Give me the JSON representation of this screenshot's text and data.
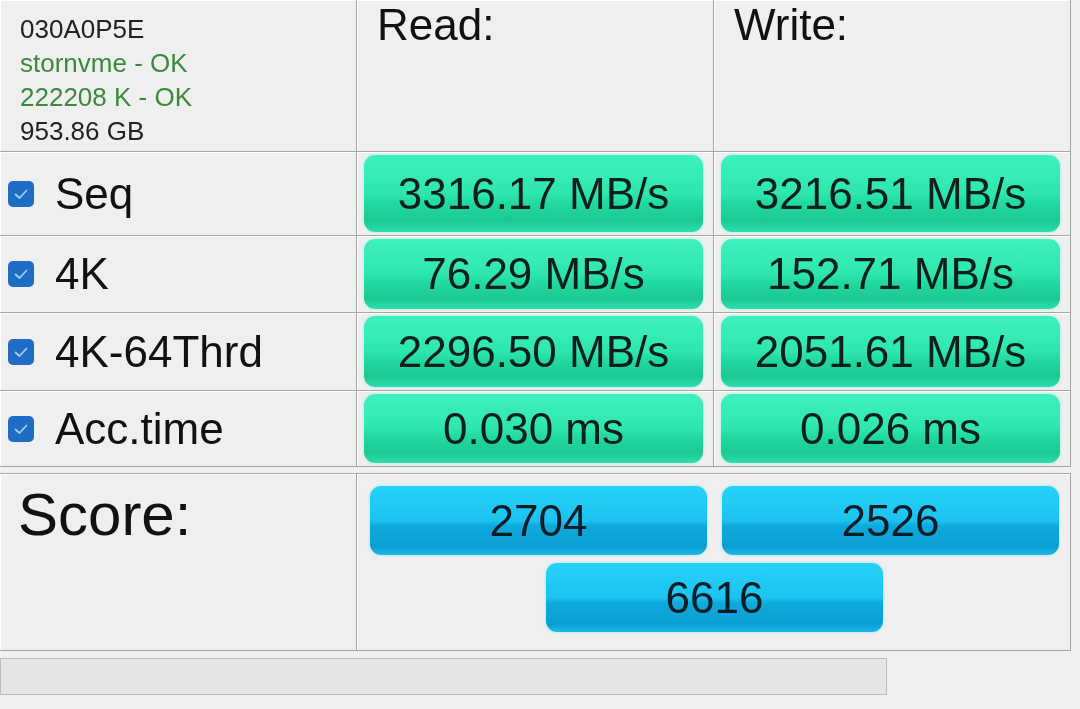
{
  "drive_info": [
    {
      "text": "030A0P5E",
      "color": "#222222"
    },
    {
      "text": "stornvme - OK",
      "color": "#3b8a3b"
    },
    {
      "text": "222208 K - OK",
      "color": "#3b8a3b"
    },
    {
      "text": "953.86 GB",
      "color": "#222222"
    }
  ],
  "columns": [
    {
      "label": "Read:"
    },
    {
      "label": "Write:"
    }
  ],
  "tests": [
    {
      "label": "Seq",
      "checked": true,
      "read": "3316.17 MB/s",
      "write": "3216.51 MB/s"
    },
    {
      "label": "4K",
      "checked": true,
      "read": "76.29 MB/s",
      "write": "152.71 MB/s"
    },
    {
      "label": "4K-64Thrd",
      "checked": true,
      "read": "2296.50 MB/s",
      "write": "2051.61 MB/s"
    },
    {
      "label": "Acc.time",
      "checked": true,
      "read": "0.030 ms",
      "write": "0.026 ms"
    }
  ],
  "score": {
    "label": "Score:",
    "read": "2704",
    "write": "2526",
    "total": "6616"
  },
  "progress": {
    "level": 0
  }
}
